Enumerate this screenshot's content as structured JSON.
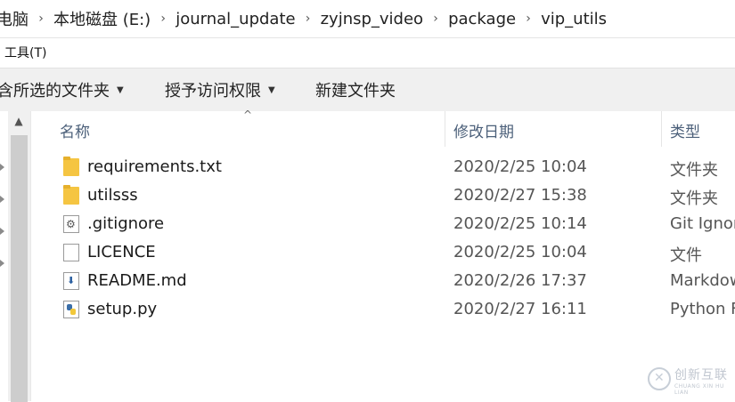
{
  "breadcrumb": [
    "电脑",
    "本地磁盘 (E:)",
    "journal_update",
    "zyjnsp_video",
    "package",
    "vip_utils"
  ],
  "menu": {
    "tools": "工具(T)"
  },
  "toolbar": {
    "include_selected": "含所选的文件夹",
    "grant_access": "授予访问权限",
    "new_folder": "新建文件夹"
  },
  "columns": {
    "name": "名称",
    "modified": "修改日期",
    "type": "类型"
  },
  "files": [
    {
      "name": "requirements.txt",
      "modified": "2020/2/25 10:04",
      "type": "文件夹",
      "icon": "folder-icon"
    },
    {
      "name": "utilsss",
      "modified": "2020/2/27 15:38",
      "type": "文件夹",
      "icon": "folder-icon"
    },
    {
      "name": ".gitignore",
      "modified": "2020/2/25 10:14",
      "type": "Git Ignor",
      "icon": "gear-file-icon"
    },
    {
      "name": "LICENCE",
      "modified": "2020/2/25 10:04",
      "type": "文件",
      "icon": "file-icon"
    },
    {
      "name": "README.md",
      "modified": "2020/2/26 17:37",
      "type": "Markdow",
      "icon": "markdown-file-icon"
    },
    {
      "name": "setup.py",
      "modified": "2020/2/27 16:11",
      "type": "Python F",
      "icon": "python-file-icon"
    }
  ],
  "watermark": {
    "text": "创新互联",
    "subtext": "CHUANG XIN HU LIAN"
  }
}
